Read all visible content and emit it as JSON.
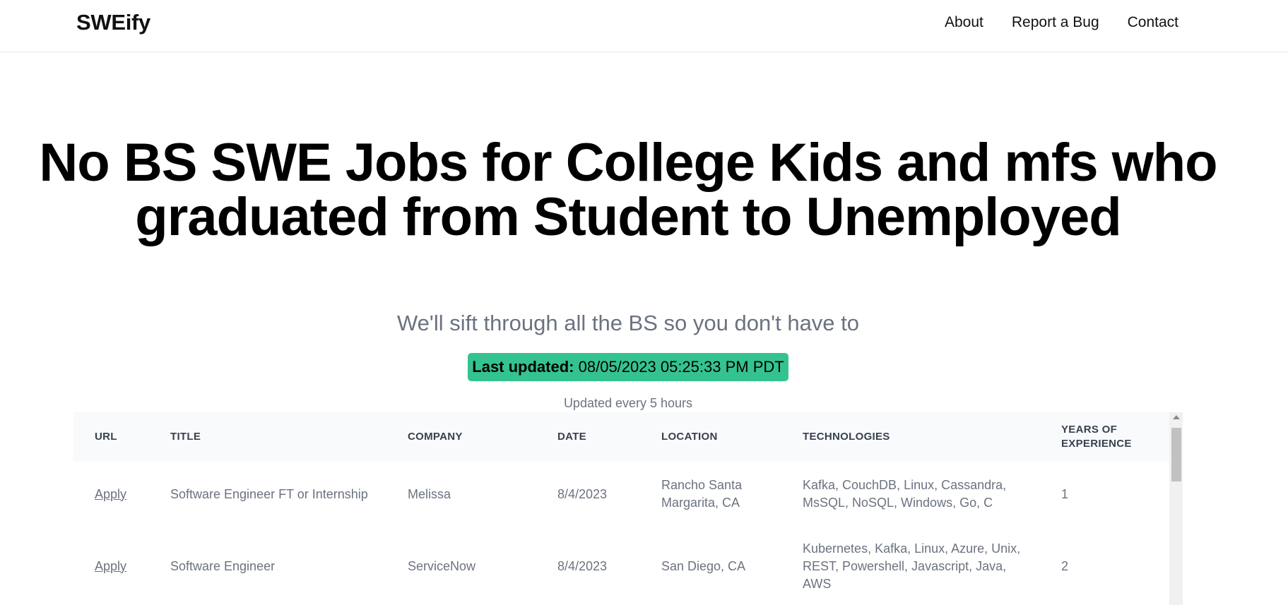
{
  "nav": {
    "brand": "SWEify",
    "links": [
      "About",
      "Report a Bug",
      "Contact"
    ]
  },
  "hero": {
    "title": "No BS SWE Jobs for College Kids and mfs who graduated from Student to Unemployed",
    "subtitle": "We'll sift through all the BS so you don't have to",
    "badge_label": "Last updated:",
    "badge_value": "08/05/2023 05:25:33 PM PDT",
    "update_note": "Updated every 5 hours"
  },
  "table": {
    "headers": [
      "URL",
      "TITLE",
      "COMPANY",
      "DATE",
      "LOCATION",
      "TECHNOLOGIES",
      "YEARS OF EXPERIENCE"
    ],
    "rows": [
      {
        "url": "Apply",
        "title": "Software Engineer FT or Internship",
        "company": "Melissa",
        "date": "8/4/2023",
        "location": "Rancho Santa Margarita, CA",
        "technologies": "Kafka, CouchDB, Linux, Cassandra, MsSQL, NoSQL, Windows, Go, C",
        "years": "1"
      },
      {
        "url": "Apply",
        "title": "Software Engineer",
        "company": "ServiceNow",
        "date": "8/4/2023",
        "location": "San Diego, CA",
        "technologies": "Kubernetes, Kafka, Linux, Azure, Unix, REST, Powershell, Javascript, Java, AWS",
        "years": "2"
      }
    ]
  },
  "colors": {
    "badge": "#34c38f",
    "muted_text": "#6b7280",
    "header_bg": "#f9fafb"
  }
}
